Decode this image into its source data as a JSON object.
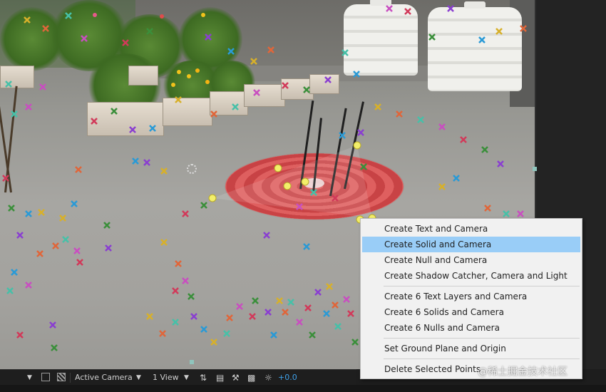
{
  "context_menu": {
    "items": [
      {
        "label": "Create Text and Camera",
        "highlighted": false
      },
      {
        "label": "Create Solid and Camera",
        "highlighted": true
      },
      {
        "label": "Create Null and Camera",
        "highlighted": false
      },
      {
        "label": "Create Shadow Catcher, Camera and Light",
        "highlighted": false
      },
      {
        "label": "Create 6 Text Layers and Camera",
        "highlighted": false
      },
      {
        "label": "Create 6 Solids and Camera",
        "highlighted": false
      },
      {
        "label": "Create 6 Nulls and Camera",
        "highlighted": false
      },
      {
        "label": "Set Ground Plane and Origin",
        "highlighted": false
      },
      {
        "label": "Delete Selected Points",
        "highlighted": false
      }
    ],
    "highlight_color": "#99cdf7"
  },
  "viewer_toolbar": {
    "camera_view": "Active Camera",
    "view_layout": "1 View",
    "exposure_value": "+0.0",
    "icons": [
      "dropdown-arrow-icon",
      "region-of-interest-icon",
      "transparency-grid-icon",
      "3d-draft-icon",
      "snapshot-icon",
      "channel-icon",
      "fast-preview-icon",
      "exposure-reset-icon"
    ]
  },
  "watermark": "@稀土掘金技术社区",
  "track_point_colors": [
    "#d13a5a",
    "#3b8f3b",
    "#8a3fd0",
    "#2a9ad6",
    "#d7b02a",
    "#e0663a",
    "#47c0a8",
    "#c84fc0"
  ]
}
